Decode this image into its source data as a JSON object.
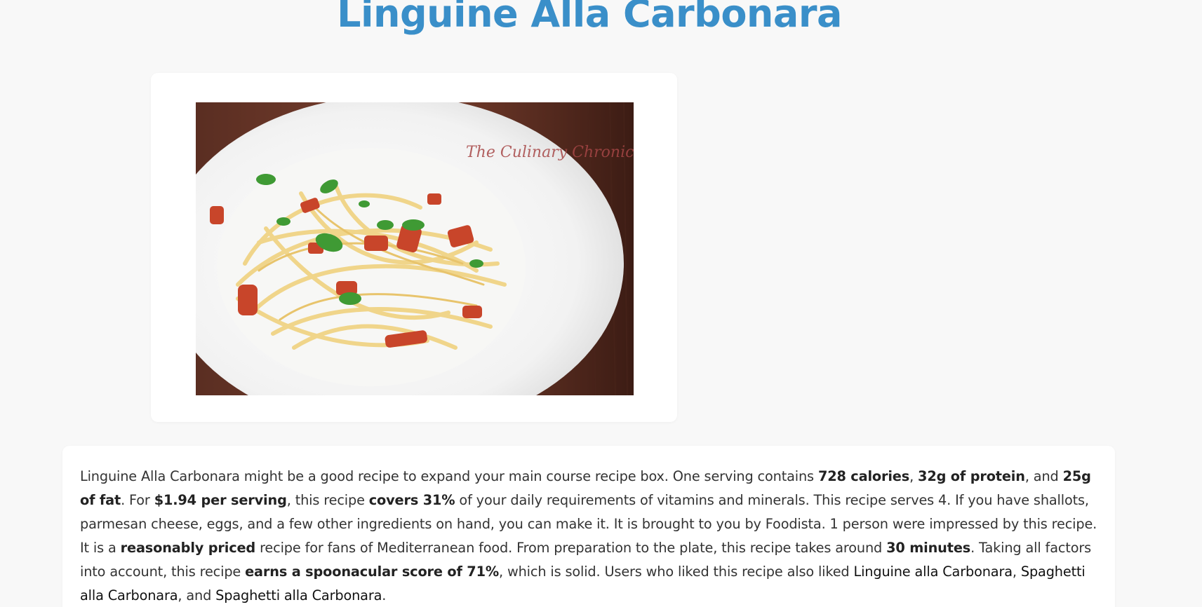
{
  "recipe": {
    "title": "Linguine Alla Carbonara",
    "image_watermark": "The Culinary Chronicles"
  },
  "summary": {
    "t1": "Linguine Alla Carbonara might be a good recipe to expand your main course recipe box. One serving contains ",
    "calories": "728 calories",
    "t2": ", ",
    "protein": "32g of protein",
    "t3": ", and ",
    "fat": "25g of fat",
    "t4": ". For ",
    "price": "$1.94 per serving",
    "t5": ", this recipe ",
    "covers": "covers 31%",
    "t6": " of your daily requirements of vitamins and minerals. This recipe serves 4. If you have shallots, parmesan cheese, eggs, and a few other ingredients on hand, you can make it. It is brought to you by Foodista. 1 person were impressed by this recipe. It is a ",
    "priced": "reasonably priced",
    "t7": " recipe for fans of Mediterranean food. From preparation to the plate, this recipe takes around ",
    "time": "30 minutes",
    "t8": ". Taking all factors into account, this recipe ",
    "score": "earns a spoonacular score of 71%",
    "t9": ", which is solid. Users who liked this recipe also liked ",
    "link1": "Linguine alla Carbonara",
    "t10": ", ",
    "link2": "Spaghetti alla Carbonara",
    "t11": ", and ",
    "link3": "Spaghetti alla Carbonara",
    "t12": "."
  },
  "colors": {
    "title": "#3a8fc9",
    "background": "#f8f8f8",
    "card": "#ffffff"
  }
}
